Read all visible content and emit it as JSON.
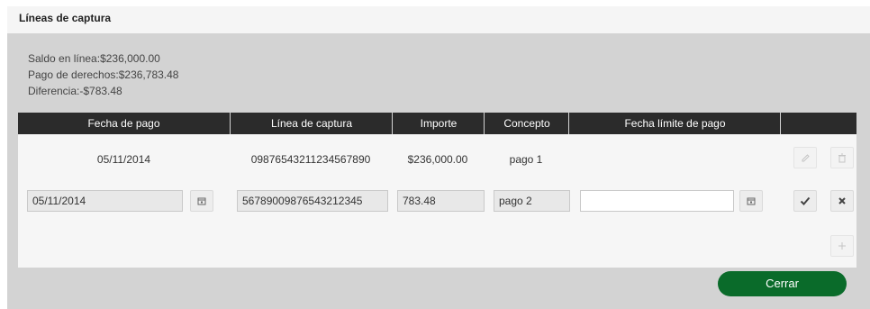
{
  "panel": {
    "title": "Líneas de captura",
    "summary": {
      "saldo": "Saldo en línea:$236,000.00",
      "pago": "Pago de derechos:$236,783.48",
      "diferencia": "Diferencia:-$783.48"
    }
  },
  "table": {
    "headers": [
      "Fecha de pago",
      "Línea de captura",
      "Importe",
      "Concepto",
      "Fecha límite de pago",
      ""
    ],
    "row1": {
      "fecha": "05/11/2014",
      "linea": "09876543211234567890",
      "importe": "$236,000.00",
      "concepto": "pago 1",
      "fecha_limite": ""
    },
    "row2": {
      "fecha": "05/11/2014",
      "linea": "56789009876543212345",
      "importe": "783.48",
      "concepto": "pago 2",
      "fecha_limite": ""
    }
  },
  "buttons": {
    "cerrar": "Cerrar"
  },
  "colors": {
    "header_bg": "#2b2b2b",
    "accent_green": "#0a6b2a"
  }
}
